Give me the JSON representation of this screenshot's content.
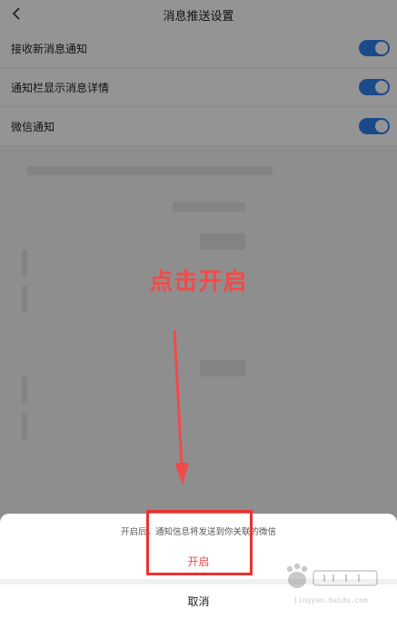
{
  "header": {
    "title": "消息推送设置",
    "back_icon": "chevron-left-icon"
  },
  "settings": [
    {
      "label": "接收新消息通知",
      "on": true
    },
    {
      "label": "通知栏显示消息详情",
      "on": true
    },
    {
      "label": "微信通知",
      "on": true
    }
  ],
  "annotation": {
    "callout": "点击开启",
    "color": "#f24a4a"
  },
  "sheet": {
    "message": "开启后，通知信息将发送到你关联的微信",
    "confirm_label": "开启",
    "cancel_label": "取消"
  },
  "colors": {
    "toggle_on": "#2f80ed",
    "accent_red": "#f24a4a"
  },
  "watermark": {
    "url": "jingyan.baidu.com"
  }
}
